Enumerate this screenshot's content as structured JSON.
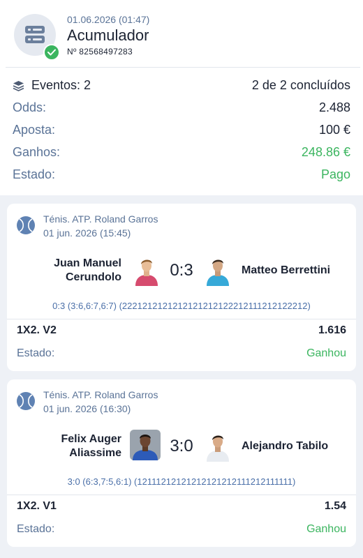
{
  "ticket": {
    "date": "01.06.2026 (01:47)",
    "title": "Acumulador",
    "number": "Nº 82568497283"
  },
  "summary": {
    "events_label": "Eventos: 2",
    "events_completed": "2 de 2 concluídos",
    "odds_label": "Odds:",
    "odds_value": "2.488",
    "stake_label": "Aposta:",
    "stake_value": "100 €",
    "winnings_label": "Ganhos:",
    "winnings_value": "248.86 €",
    "status_label": "Estado:",
    "status_value": "Pago"
  },
  "events": [
    {
      "tournament": "Ténis. ATP. Roland Garros",
      "date": "01 jun. 2026 (15:45)",
      "player1_line1": "Juan Manuel",
      "player1_line2": "Cerundolo",
      "score": "0:3",
      "player2": "Matteo Berrettini",
      "detail": "0:3 (3:6,6:7,6:7) (2221212121212121212122212111212122212)",
      "bet": "1X2. V2",
      "odd": "1.616",
      "status_label": "Estado:",
      "status_value": "Ganhou"
    },
    {
      "tournament": "Ténis. ATP. Roland Garros",
      "date": "01 jun. 2026 (16:30)",
      "player1_line1": "Felix Auger",
      "player1_line2": "Aliassime",
      "score": "3:0",
      "player2": "Alejandro Tabilo",
      "detail": "3:0 (6:3,7:5,6:1) (12111212121212121212111212111111)",
      "bet": "1X2. V1",
      "odd": "1.54",
      "status_label": "Estado:",
      "status_value": "Ganhou"
    }
  ],
  "colors": {
    "accent_green": "#3bb55f",
    "label_blue": "#5a7397",
    "background": "#eef1f6"
  },
  "icons": [
    "ticket-icon",
    "check-icon",
    "layers-icon",
    "tennis-ball-icon",
    "player-photo"
  ]
}
